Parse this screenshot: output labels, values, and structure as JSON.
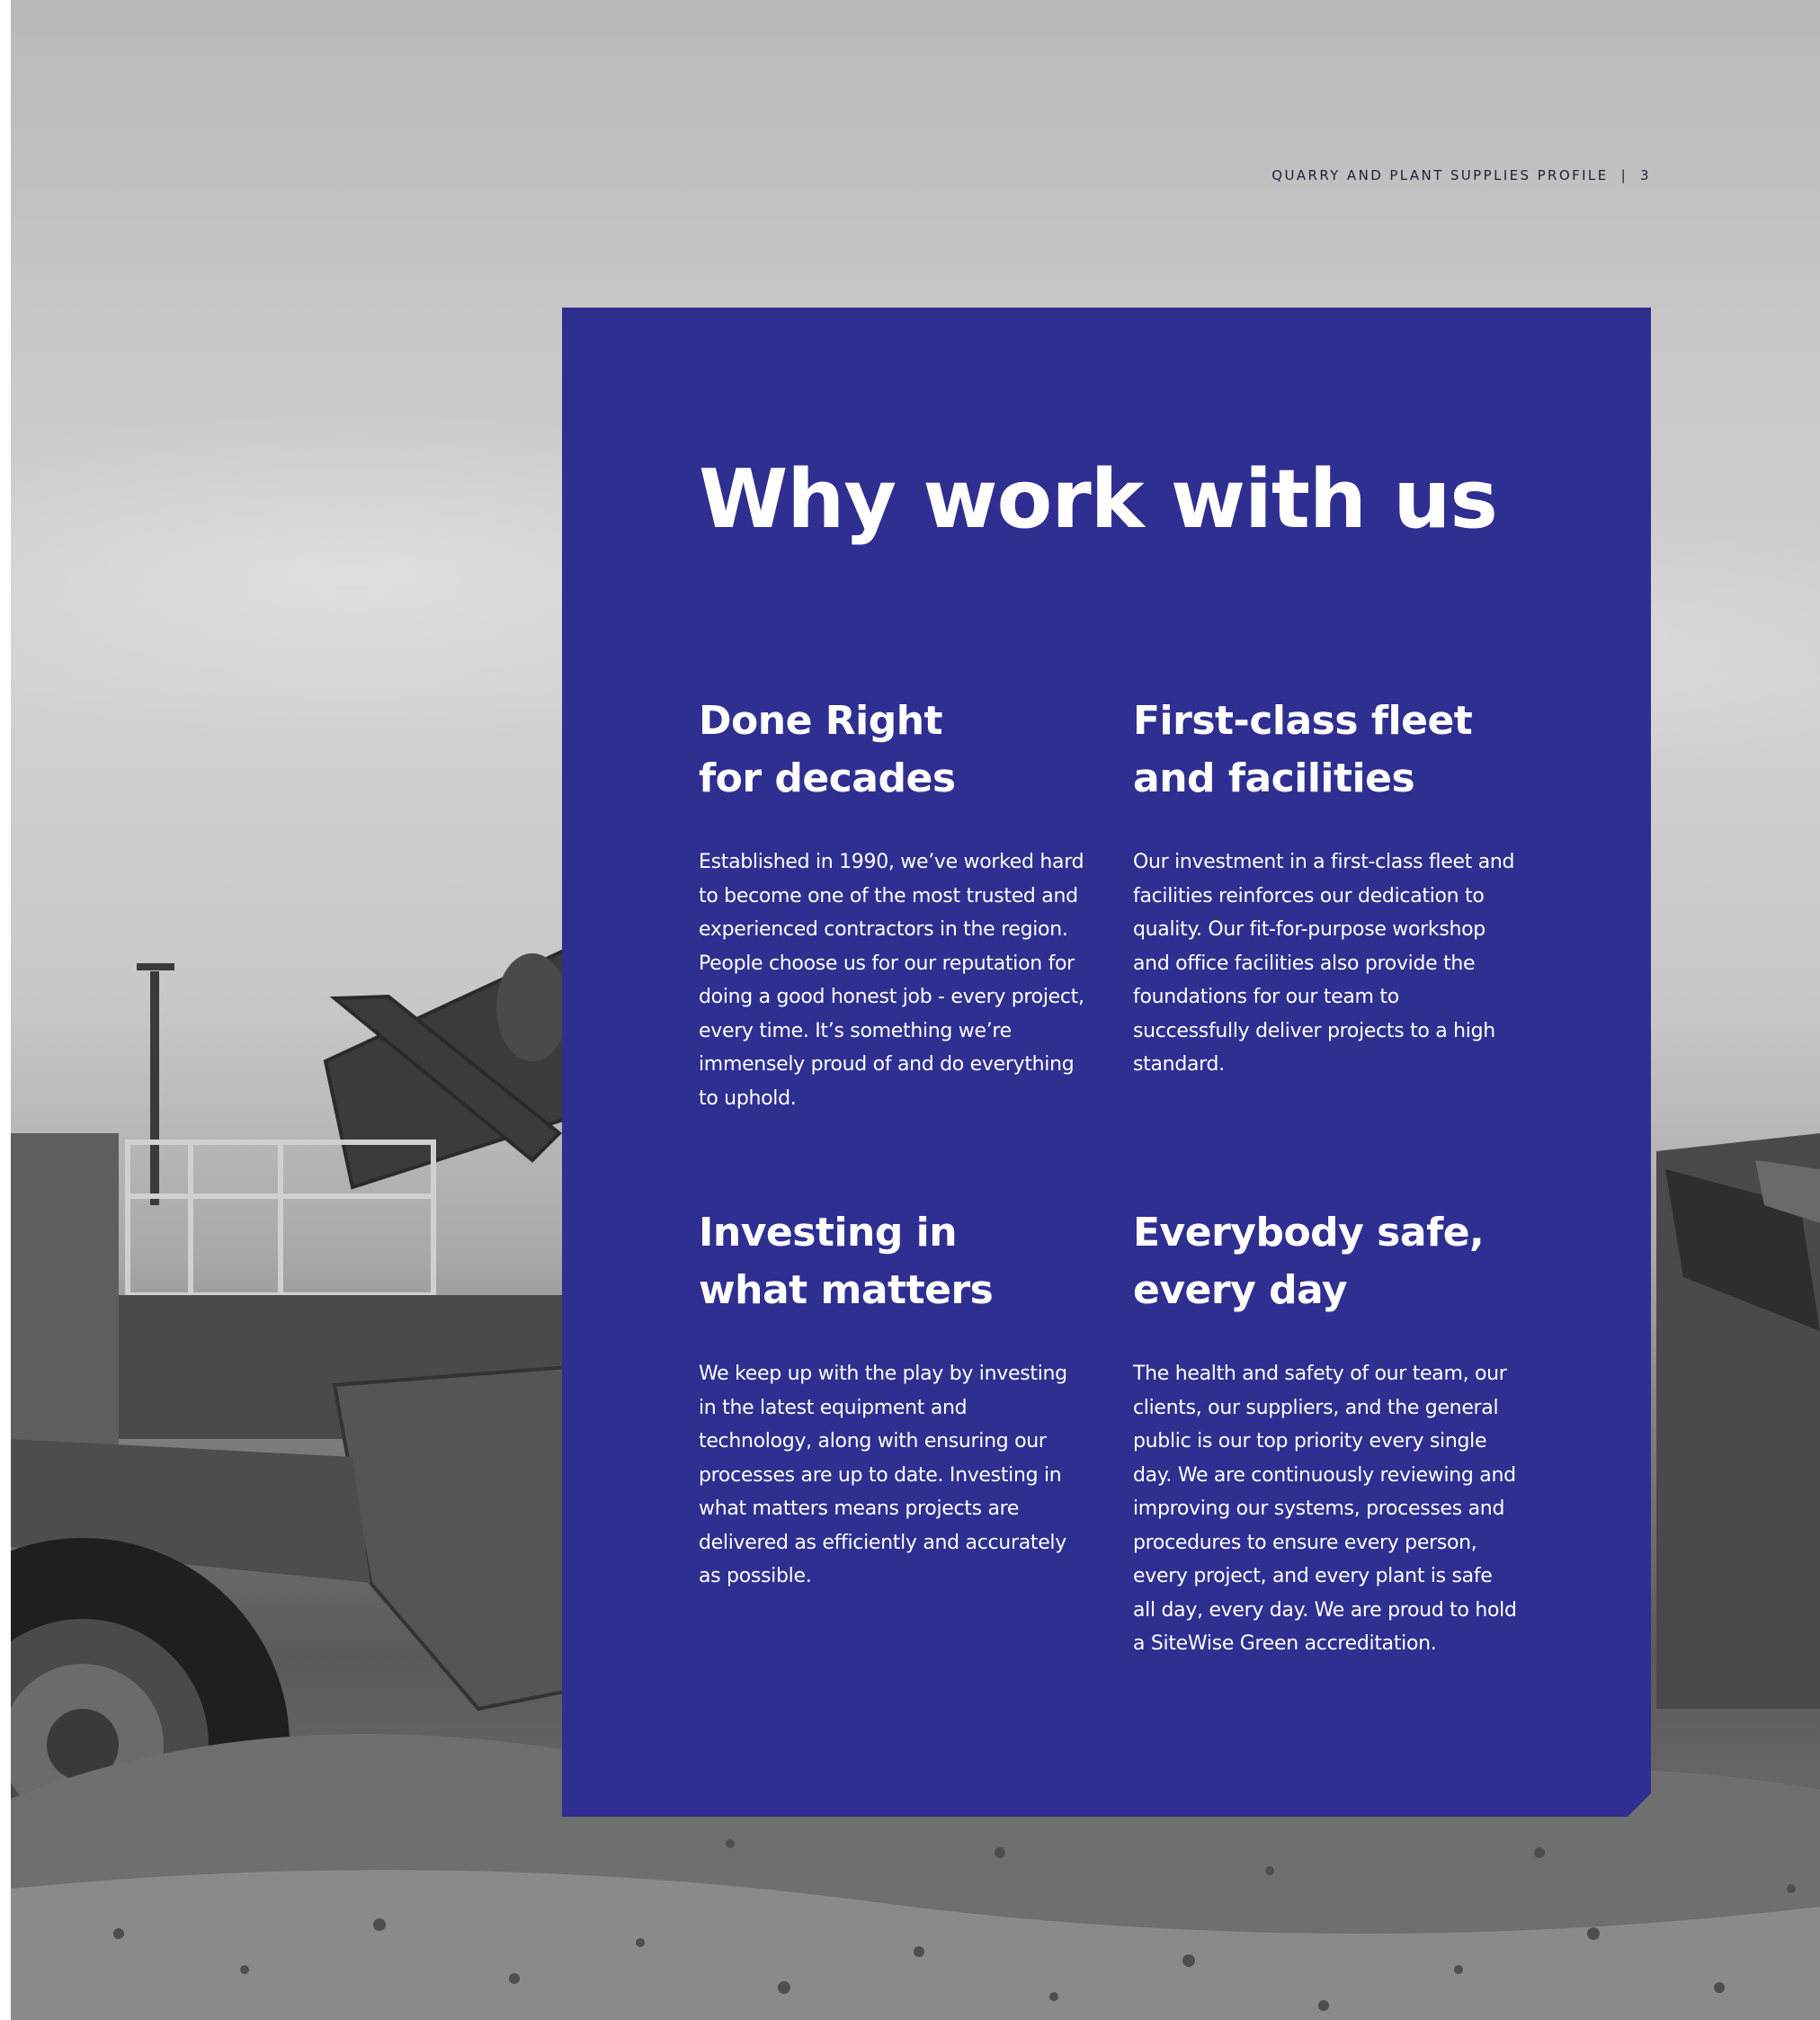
{
  "header": {
    "publication": "QUARRY AND PLANT SUPPLIES PROFILE",
    "separator": "|",
    "page_number": "3"
  },
  "title": "Why work with us",
  "sections": [
    {
      "heading_line1": "Done Right",
      "heading_line2": "for decades",
      "body": "Established in 1990, we’ve worked hard to become one of the most trusted and experienced contractors in the region. People choose us for our reputation for doing a good honest job - every project, every time. It’s something we’re immensely proud of and do everything to uphold."
    },
    {
      "heading_line1": "First-class fleet",
      "heading_line2": "and facilities",
      "body": "Our investment in a first-class fleet and facilities reinforces our dedication to quality. Our fit-for-purpose workshop and office facilities also provide the foundations for our team to successfully deliver projects to a high standard."
    },
    {
      "heading_line1": "Investing in",
      "heading_line2": "what matters",
      "body": "We keep up with the play by investing in the latest equipment and technology, along with ensuring our processes are up to date. Investing in what matters means projects are delivered as efficiently and accurately as possible."
    },
    {
      "heading_line1": "Everybody safe,",
      "heading_line2": "every day",
      "body": "The health and safety of our team, our clients, our suppliers, and the general public is our top priority every single day. We are continuously reviewing and improving our systems, processes and procedures to ensure every person, every project, and every plant is safe all day, every day. We are proud to hold a SiteWise Green accreditation."
    }
  ],
  "colors": {
    "panel": "#2e2f91",
    "text_on_panel": "#ffffff",
    "header_text": "#1f1f3a"
  },
  "image": {
    "description_icon": "quarry-machinery-photo"
  }
}
